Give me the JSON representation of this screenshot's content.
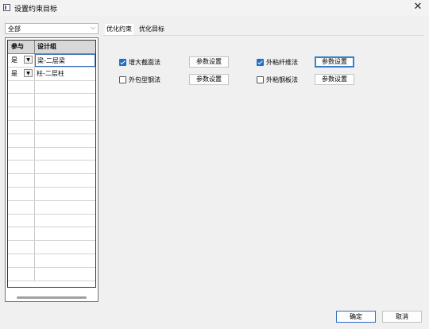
{
  "window": {
    "title": "设置约束目标"
  },
  "filter": {
    "value": "全部"
  },
  "grid": {
    "headers": [
      "参与",
      "设计组"
    ],
    "rows": [
      {
        "participate": "是",
        "group": "梁-二层梁"
      },
      {
        "participate": "是",
        "group": "柱-二层柱"
      }
    ]
  },
  "tabs": [
    {
      "label": "优化约束"
    },
    {
      "label": "优化目标"
    }
  ],
  "options": [
    {
      "label": "增大截面法",
      "checked": true
    },
    {
      "label": "外粘纤维法",
      "checked": true
    },
    {
      "label": "外包型钢法",
      "checked": false
    },
    {
      "label": "外粘钢板法",
      "checked": false
    }
  ],
  "param_button_label": "参数设置",
  "footer": {
    "ok_label": "确定",
    "cancel_label": "取消"
  }
}
